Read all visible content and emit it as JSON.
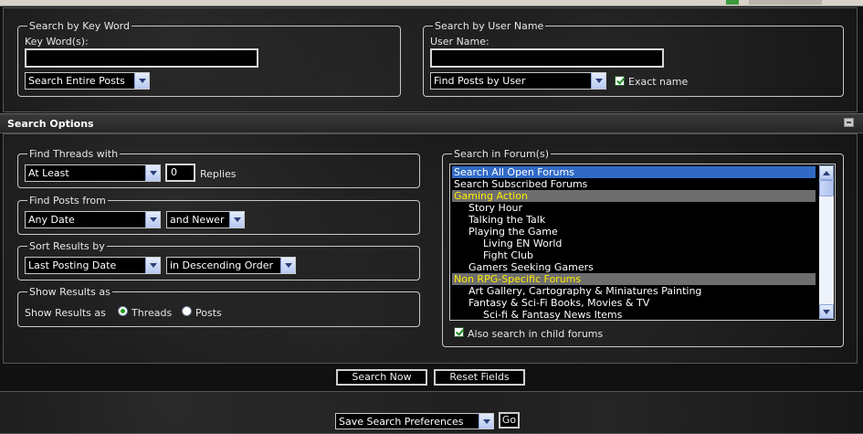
{
  "keyword": {
    "legend": "Search by Key Word",
    "label": "Key Word(s):",
    "value": "",
    "scope_select": "Search Entire Posts"
  },
  "username": {
    "legend": "Search by User Name",
    "label": "User Name:",
    "value": "",
    "mode_select": "Find Posts by User",
    "exact_label": "Exact name",
    "exact_checked": true
  },
  "options": {
    "title": "Search Options",
    "threads": {
      "legend": "Find Threads with",
      "select": "At Least",
      "count": "0",
      "suffix": "Replies"
    },
    "posts_from": {
      "legend": "Find Posts from",
      "date_select": "Any Date",
      "direction_select": "and Newer"
    },
    "sort": {
      "legend": "Sort Results by",
      "field_select": "Last Posting Date",
      "order_select": "in Descending Order"
    },
    "show": {
      "legend": "Show Results as",
      "label": "Show Results as",
      "threads_label": "Threads",
      "posts_label": "Posts",
      "selected": "Threads"
    },
    "forums": {
      "legend": "Search in Forum(s)",
      "items": [
        {
          "label": "Search All Open Forums",
          "state": "selected",
          "indent": 0
        },
        {
          "label": "Search Subscribed Forums",
          "state": "normal",
          "indent": 0
        },
        {
          "label": "Gaming Action",
          "state": "category",
          "indent": 0
        },
        {
          "label": "Story Hour",
          "state": "normal",
          "indent": 1
        },
        {
          "label": "Talking the Talk",
          "state": "normal",
          "indent": 1
        },
        {
          "label": "Playing the Game",
          "state": "normal",
          "indent": 1
        },
        {
          "label": "Living EN World",
          "state": "normal",
          "indent": 2
        },
        {
          "label": "Fight Club",
          "state": "normal",
          "indent": 2
        },
        {
          "label": "Gamers Seeking Gamers",
          "state": "normal",
          "indent": 1
        },
        {
          "label": "Non RPG-Specific Forums",
          "state": "category",
          "indent": 0
        },
        {
          "label": "Art Gallery, Cartography & Miniatures Painting",
          "state": "normal",
          "indent": 1
        },
        {
          "label": "Fantasy & Sci-Fi Books, Movies & TV",
          "state": "normal",
          "indent": 1
        },
        {
          "label": "Sci-fi & Fantasy News Items",
          "state": "normal",
          "indent": 2
        }
      ],
      "child_label": "Also search in child forums",
      "child_checked": true
    }
  },
  "buttons": {
    "search": "Search Now",
    "reset": "Reset Fields"
  },
  "prefs": {
    "select": "Save Search Preferences",
    "go": "Go"
  }
}
